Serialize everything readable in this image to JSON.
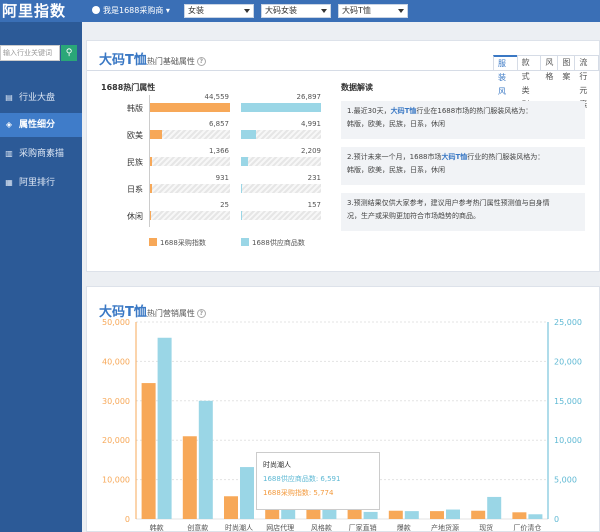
{
  "header": {
    "brand": "阿里指数",
    "user": "我是1688采购商",
    "selects": [
      "女装",
      "大码女装",
      "大码T恤"
    ]
  },
  "sidebar": {
    "search_placeholder": "输入行业关键词",
    "items": [
      {
        "label": "行业大盘",
        "icon": "chart-icon"
      },
      {
        "label": "属性细分",
        "icon": "layers-icon"
      },
      {
        "label": "采购商素描",
        "icon": "bars-icon"
      },
      {
        "label": "阿里排行",
        "icon": "ranking-icon"
      }
    ]
  },
  "panel1": {
    "title": "大码T恤",
    "subtitle": "热门基础属性",
    "tabs": [
      "服装风格",
      "款式类别",
      "风格",
      "图案",
      "流行元素"
    ],
    "section_left": "1688热门属性",
    "section_right": "数据解读",
    "rows": [
      {
        "name": "韩版",
        "buy": "44,559",
        "supply": "26,897",
        "buy_frac": 1.0,
        "supply_frac": 1.0
      },
      {
        "name": "欧美",
        "buy": "6,857",
        "supply": "4,991",
        "buy_frac": 0.154,
        "supply_frac": 0.186
      },
      {
        "name": "民族",
        "buy": "1,366",
        "supply": "2,209",
        "buy_frac": 0.031,
        "supply_frac": 0.082
      },
      {
        "name": "日系",
        "buy": "931",
        "supply": "231",
        "buy_frac": 0.021,
        "supply_frac": 0.009
      },
      {
        "name": "休闲",
        "buy": "25",
        "supply": "157",
        "buy_frac": 0.001,
        "supply_frac": 0.006
      }
    ],
    "legend": [
      "1688采购指数",
      "1688供应商品数"
    ],
    "interp": [
      {
        "pre": "1.最近30天，",
        "hl": "大码T恤",
        "post": "行业在1688市场的热门服装风格为：",
        "line2": "韩版，欧美，民族，日系，休闲"
      },
      {
        "pre": "2.预计未来一个月，1688市场",
        "hl": "大码T恤",
        "post": "行业的热门服装风格为：",
        "line2": "韩版，欧美，民族，日系，休闲"
      },
      {
        "pre": "3.预测结果仅供大家参考，建议用户参考热门属性预测值与自身情",
        "hl": "",
        "post": "",
        "line2": "况，生产或采购更加符合市场趋势的商品。"
      }
    ]
  },
  "panel2": {
    "title": "大码T恤",
    "subtitle": "热门营销属性",
    "tooltip": {
      "title": "时尚潮人",
      "supply": "1688供应商品数: 6,591",
      "buy": "1688采购指数: 5,774"
    }
  },
  "chart_data": {
    "type": "bar",
    "categories": [
      "韩款",
      "创意款",
      "时尚潮人",
      "网店代理",
      "风格款",
      "厂家直销",
      "爆款",
      "产地货源",
      "现货",
      "厂价清仓"
    ],
    "series": [
      {
        "name": "1688采购指数",
        "axis": "left",
        "color": "#f7a858",
        "values": [
          34500,
          21000,
          5774,
          3000,
          2700,
          2300,
          2100,
          2000,
          2100,
          1700
        ]
      },
      {
        "name": "1688供应商品数",
        "axis": "right",
        "color": "#9ad6e6",
        "values": [
          23000,
          15000,
          6591,
          2000,
          1200,
          900,
          1000,
          1200,
          2800,
          600
        ]
      }
    ],
    "yleft": {
      "min": 0,
      "max": 50000,
      "ticks": [
        "0",
        "10,000",
        "20,000",
        "30,000",
        "40,000",
        "50,000"
      ]
    },
    "yright": {
      "min": 0,
      "max": 25000,
      "ticks": [
        "0",
        "5,000",
        "10,000",
        "15,000",
        "20,000",
        "25,000"
      ]
    },
    "colors": {
      "left": "#f7a858",
      "right": "#9ad6e6"
    }
  }
}
